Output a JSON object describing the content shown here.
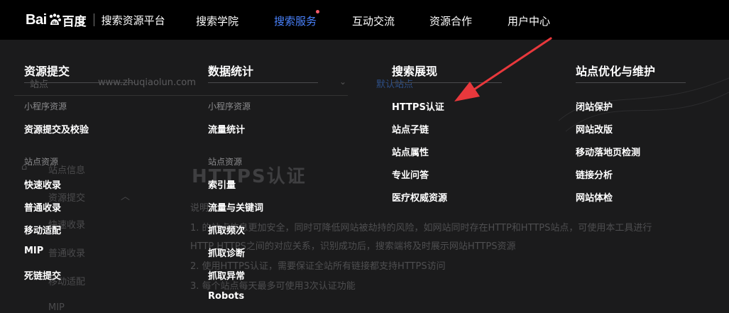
{
  "header": {
    "logo_bai": "Bai",
    "logo_du": "百度",
    "platform_title": "搜索资源平台",
    "nav": [
      "搜索学院",
      "搜索服务",
      "互动交流",
      "资源合作",
      "用户中心"
    ]
  },
  "background": {
    "field_label": "站点",
    "field_value": "www.zhuqiaolun.com",
    "field_link": "默认站点",
    "heading": "HTTPS认证",
    "intro_label": "说明",
    "lines": [
      "1. 的站点信息更加安全，同时可降低网站被劫持的风险，如网站同时存在HTTP和HTTPS站点，可使用本工具进行",
      "HTTP HTTPS之间的对应关系，识别成功后，搜索端将及时展示网站HTTPS资源",
      "2. 使用HTTPS认证，需要保证全站所有链接都支持HTTPS访问",
      "3. 每个站点每天最多可使用3次认证功能"
    ],
    "side": [
      "站点信息",
      "资源提交",
      "快速收录",
      "普通收录",
      "移动适配",
      "MIP"
    ]
  },
  "menu": {
    "columns": [
      {
        "title": "资源提交",
        "groups": [
          {
            "label": "小程序资源",
            "items": [
              "资源提交及校验"
            ]
          },
          {
            "label": "站点资源",
            "items": [
              "快速收录",
              "普通收录",
              "移动适配",
              "MIP",
              "死链提交"
            ]
          }
        ]
      },
      {
        "title": "数据统计",
        "groups": [
          {
            "label": "小程序资源",
            "items": [
              "流量统计"
            ]
          },
          {
            "label": "站点资源",
            "items": [
              "索引量",
              "流量与关键词",
              "抓取频次",
              "抓取诊断",
              "抓取异常",
              "Robots"
            ]
          }
        ]
      },
      {
        "title": "搜索展现",
        "items": [
          "HTTPS认证",
          "站点子链",
          "站点属性",
          "专业问答",
          "医疗权威资源"
        ]
      },
      {
        "title": "站点优化与维护",
        "items": [
          "闭站保护",
          "网站改版",
          "移动落地页检测",
          "链接分析",
          "网站体检"
        ]
      }
    ]
  },
  "colors": {
    "nav_active": "#4a83ff",
    "nav_dot": "#f45b69",
    "annotation_arrow": "#e8383c"
  }
}
